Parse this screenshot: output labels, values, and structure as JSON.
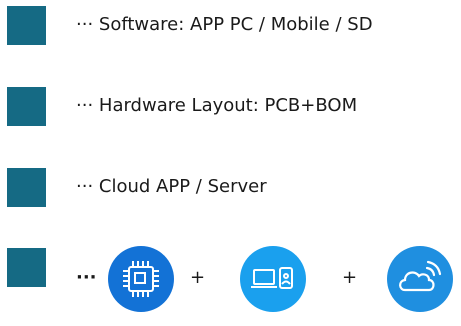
{
  "colors": {
    "square": "#156a84",
    "chip_circle": "#1372d6",
    "device_circle": "#1aa0ee",
    "cloud_circle": "#1f8fe0",
    "text": "#1a1a1a"
  },
  "rows": [
    {
      "prefix": "···",
      "text": "Software: APP PC / Mobile / SD"
    },
    {
      "prefix": "···",
      "text": "Hardware Layout: PCB+BOM"
    },
    {
      "prefix": "···",
      "text": "Cloud APP / Server"
    }
  ],
  "bottom": {
    "prefix": "···",
    "plus_1": "+",
    "plus_2": "+",
    "icons": [
      "chip-icon",
      "laptop-phone-icon",
      "cloud-wireless-icon"
    ]
  }
}
